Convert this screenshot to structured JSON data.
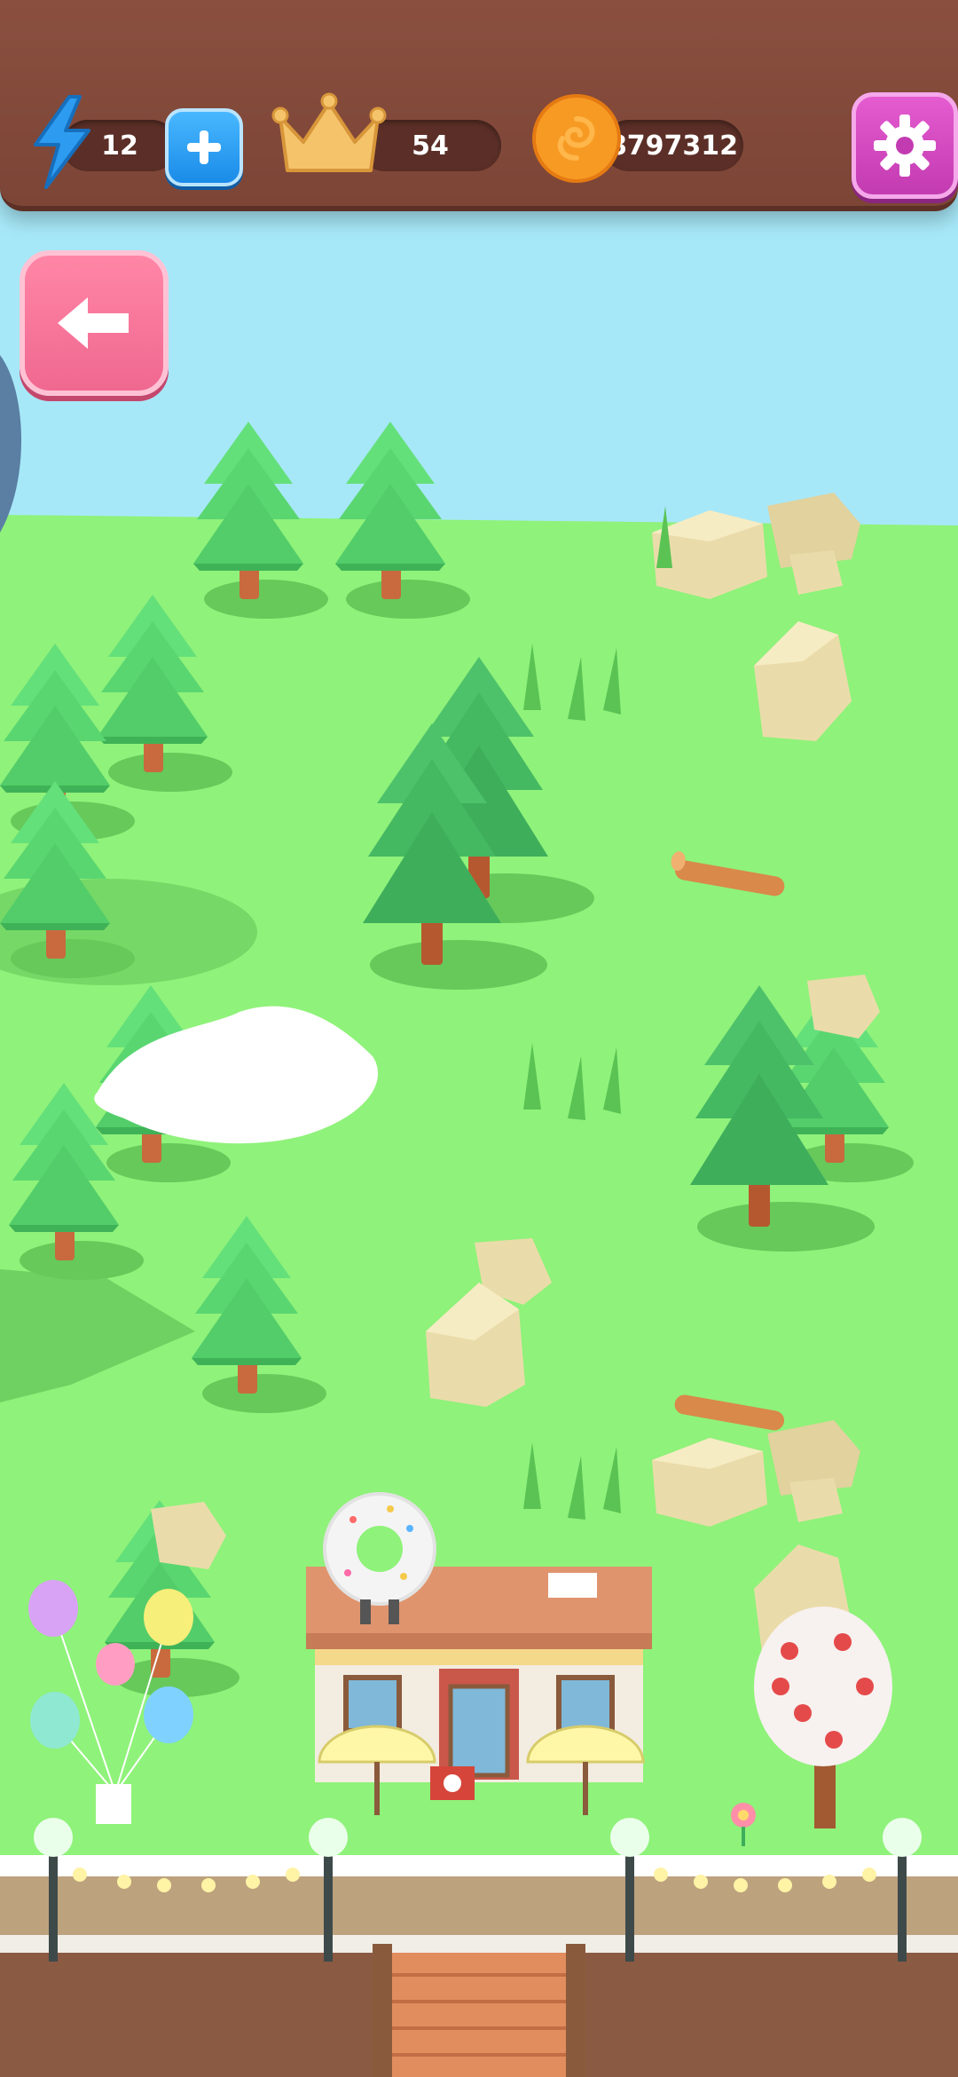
{
  "hud": {
    "energy": {
      "value": "12",
      "icon": "lightning-icon",
      "add_icon": "plus-icon"
    },
    "crowns": {
      "value": "54",
      "icon": "crown-icon"
    },
    "coins": {
      "value": "8797312",
      "icon": "coin-icon"
    },
    "settings_icon": "gear-icon"
  },
  "navigation": {
    "back_icon": "back-arrow-icon"
  },
  "colors": {
    "sky": "#a7e8f8",
    "grass": "#8ff27a",
    "tree": "#55d96e",
    "rock": "#eadcaa",
    "hud_bar": "#7c4536",
    "energy_button": "#1a8be8",
    "settings_button": "#c33bb1",
    "back_button": "#f06890"
  }
}
